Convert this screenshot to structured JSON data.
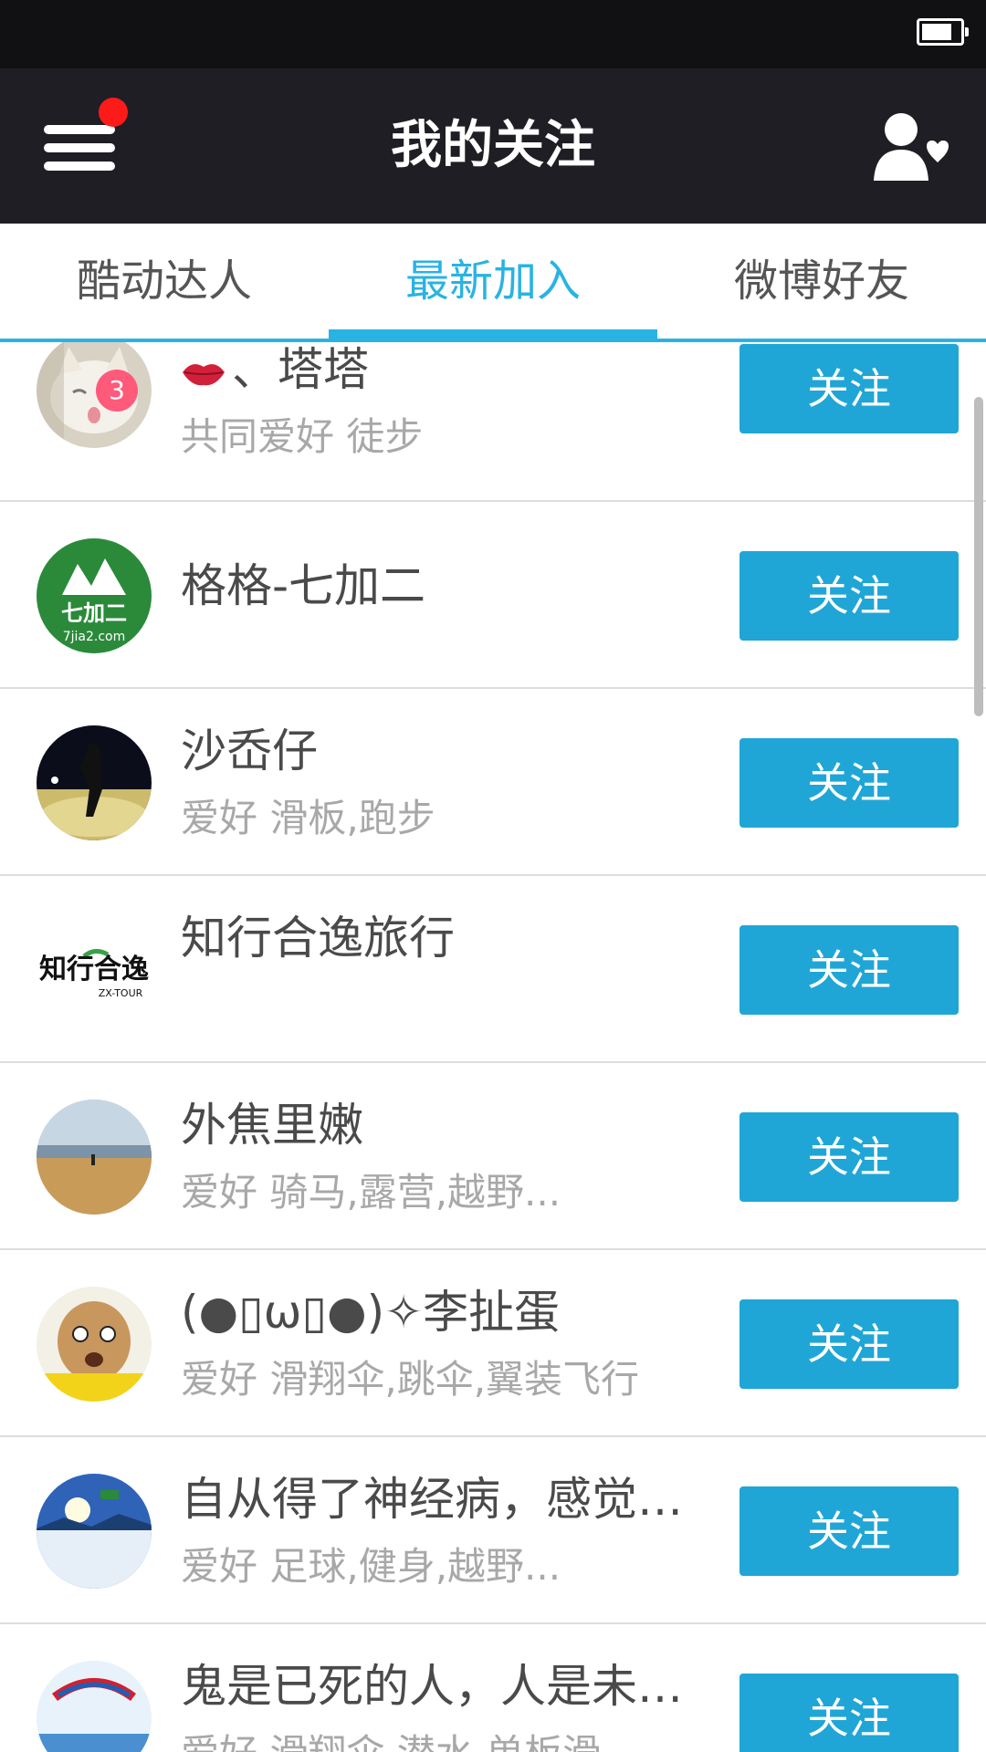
{
  "header": {
    "title": "我的关注",
    "menu_icon": "hamburger-menu-icon",
    "action_icon": "add-friend-icon"
  },
  "tabs": [
    {
      "label": "酷动达人",
      "active": false
    },
    {
      "label": "最新加入",
      "active": true
    },
    {
      "label": "微博好友",
      "active": false
    }
  ],
  "users": [
    {
      "name": "、塔塔",
      "hobby": "共同爱好 徒步",
      "button": "关注",
      "badge": "3"
    },
    {
      "name": "格格-七加二",
      "hobby": "",
      "button": "关注"
    },
    {
      "name": "沙岙仔",
      "hobby": "爱好 滑板,跑步",
      "button": "关注"
    },
    {
      "name": "知行合逸旅行",
      "hobby": "",
      "button": "关注"
    },
    {
      "name": "外焦里嫩",
      "hobby": "爱好 骑马,露营,越野...",
      "button": "关注"
    },
    {
      "name": "(●▯ω▯●)✧李扯蛋",
      "hobby": "爱好 滑翔伞,跳伞,翼装飞行",
      "button": "关注"
    },
    {
      "name": "自从得了神经病，感觉…",
      "hobby": "爱好 足球,健身,越野...",
      "button": "关注"
    },
    {
      "name": "鬼是已死的人，人是未…",
      "hobby": "爱好 滑翔伞,潜水,单板滑",
      "button": "关注"
    }
  ],
  "avatars": {
    "logo_1_text": "七加二",
    "logo_1_sub": "7jia2.com",
    "logo_2_text": "知行合逸",
    "logo_2_sub": "ZX-TOUR"
  },
  "colors": {
    "accent": "#29b3e3",
    "button": "#1fa6d6",
    "app_bar": "#1f1e25",
    "badge": "#ff5a7a"
  }
}
